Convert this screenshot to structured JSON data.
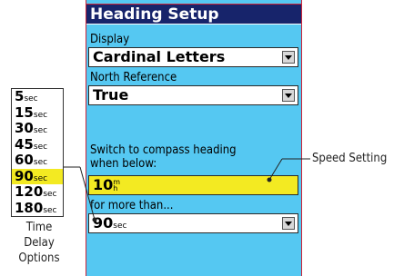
{
  "screen": {
    "title": "Heading Setup",
    "display_label": "Display",
    "display_value": "Cardinal Letters",
    "north_ref_label": "North Reference",
    "north_ref_value": "True",
    "switch_label_line1": "Switch to compass heading",
    "switch_label_line2": "when below:",
    "speed_value": "10",
    "speed_unit_top": "m",
    "speed_unit_bottom": "h",
    "more_than_label": "for more than...",
    "time_value": "90",
    "time_unit": "sec"
  },
  "time_list": {
    "items": [
      {
        "value": "5",
        "unit": "sec"
      },
      {
        "value": "15",
        "unit": "sec"
      },
      {
        "value": "30",
        "unit": "sec"
      },
      {
        "value": "45",
        "unit": "sec"
      },
      {
        "value": "60",
        "unit": "sec"
      },
      {
        "value": "90",
        "unit": "sec"
      },
      {
        "value": "120",
        "unit": "sec"
      },
      {
        "value": "180",
        "unit": "sec"
      }
    ],
    "selected_index": 5
  },
  "captions": {
    "speed_setting": "Speed Setting",
    "time_delay_line1": "Time Delay",
    "time_delay_line2": "Options"
  },
  "colors": {
    "screen_bg": "#55c8f2",
    "title_bg": "#17246b",
    "highlight": "#f3ea22"
  }
}
